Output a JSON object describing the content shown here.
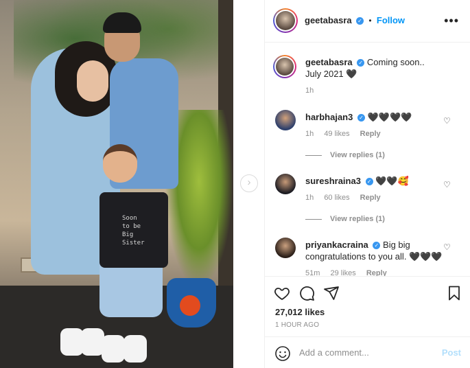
{
  "post": {
    "username": "geetabasra",
    "follow_label": "Follow",
    "separator": "•",
    "more_label": "•••"
  },
  "photo": {
    "shirt_text": "Soon\nto be\nBig\nSister"
  },
  "caption": {
    "username": "geetabasra",
    "text": "Coming soon.. July 2021 🖤",
    "time": "1h"
  },
  "comments": [
    {
      "username": "harbhajan3",
      "text": "🖤🖤🖤🖤",
      "time": "1h",
      "likes": "49 likes",
      "reply": "Reply",
      "view_replies": "View replies (1)"
    },
    {
      "username": "sureshraina3",
      "text": "🖤🖤🥰",
      "time": "1h",
      "likes": "60 likes",
      "reply": "Reply",
      "view_replies": "View replies (1)"
    },
    {
      "username": "priyankacraina",
      "text": "Big big congratulations to you all. 🖤🖤🖤",
      "time": "51m",
      "likes": "29 likes",
      "reply": "Reply"
    }
  ],
  "stats": {
    "likes": "27,012 likes",
    "time": "1 HOUR AGO"
  },
  "add_comment": {
    "placeholder": "Add a comment...",
    "post_label": "Post"
  },
  "colors": {
    "accent": "#0095f6",
    "verified": "#3897f0",
    "post_disabled": "#b2dffc"
  }
}
